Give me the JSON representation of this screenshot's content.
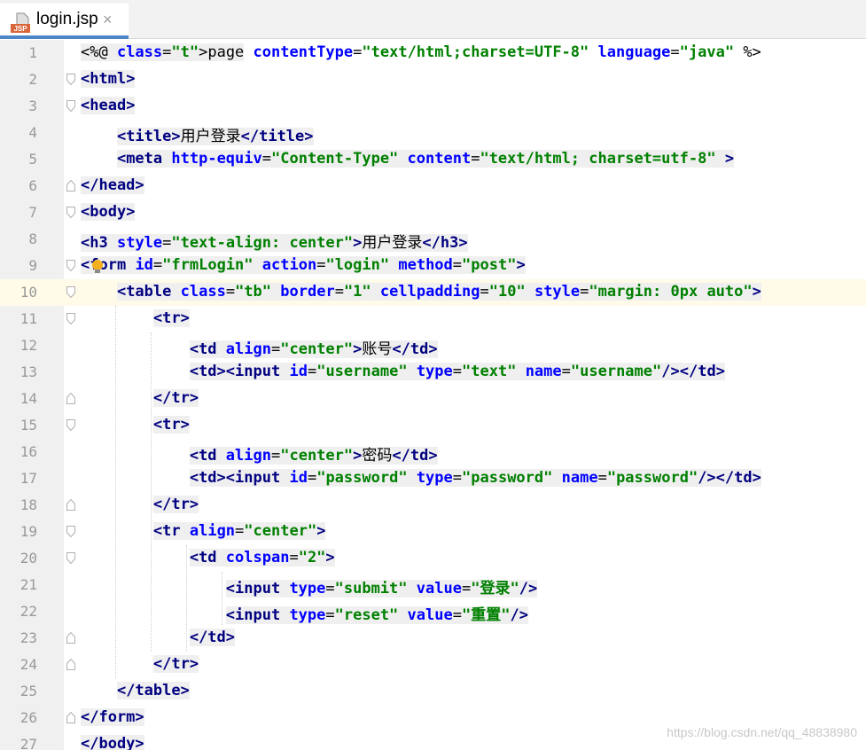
{
  "tab": {
    "label": "login.jsp",
    "close": "×",
    "icon_text": "JSP"
  },
  "lines": [
    {
      "n": "1",
      "code": "<%@ page contentType=\"text/html;charset=UTF-8\" language=\"java\" %>"
    },
    {
      "n": "2",
      "code": "<html>"
    },
    {
      "n": "3",
      "code": "<head>"
    },
    {
      "n": "4",
      "code": "    <title>用户登录</title>"
    },
    {
      "n": "5",
      "code": "    <meta http-equiv=\"Content-Type\" content=\"text/html; charset=utf-8\" >"
    },
    {
      "n": "6",
      "code": "</head>"
    },
    {
      "n": "7",
      "code": "<body>"
    },
    {
      "n": "8",
      "code": "<h3 style=\"text-align: center\">用户登录</h3>"
    },
    {
      "n": "9",
      "code": "<form id=\"frmLogin\" action=\"login\" method=\"post\">"
    },
    {
      "n": "10",
      "code": "    <table class=\"tb\" border=\"1\" cellpadding=\"10\" style=\"margin: 0px auto\">"
    },
    {
      "n": "11",
      "code": "        <tr>"
    },
    {
      "n": "12",
      "code": "            <td align=\"center\">账号</td>"
    },
    {
      "n": "13",
      "code": "            <td><input id=\"username\" type=\"text\" name=\"username\"/></td>"
    },
    {
      "n": "14",
      "code": "        </tr>"
    },
    {
      "n": "15",
      "code": "        <tr>"
    },
    {
      "n": "16",
      "code": "            <td align=\"center\">密码</td>"
    },
    {
      "n": "17",
      "code": "            <td><input id=\"password\" type=\"password\" name=\"password\"/></td>"
    },
    {
      "n": "18",
      "code": "        </tr>"
    },
    {
      "n": "19",
      "code": "        <tr align=\"center\">"
    },
    {
      "n": "20",
      "code": "            <td colspan=\"2\">"
    },
    {
      "n": "21",
      "code": "                <input type=\"submit\" value=\"登录\"/>"
    },
    {
      "n": "22",
      "code": "                <input type=\"reset\" value=\"重置\"/>"
    },
    {
      "n": "23",
      "code": "            </td>"
    },
    {
      "n": "24",
      "code": "        </tr>"
    },
    {
      "n": "25",
      "code": "    </table>"
    },
    {
      "n": "26",
      "code": "</form>"
    },
    {
      "n": "27",
      "code": "</body>"
    }
  ],
  "current_line": "10",
  "watermark": "https://blog.csdn.net/qq_48838980",
  "colors": {
    "tag": "#000080",
    "attr": "#0000ff",
    "value": "#008000",
    "current_line_bg": "#fffbe8",
    "tab_underline": "#4a86c8"
  }
}
